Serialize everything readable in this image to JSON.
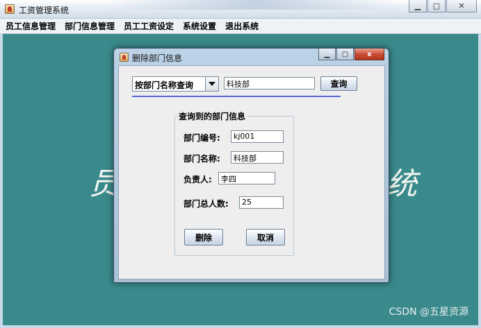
{
  "main_window": {
    "title": "工资管理系统",
    "controls": {
      "minimize": "▁",
      "maximize": "▢",
      "close": "✕"
    }
  },
  "menu": {
    "items": [
      "员工信息管理",
      "部门信息管理",
      "员工工资设定",
      "系统设置",
      "退出系统"
    ]
  },
  "background": {
    "left_glyph": "员",
    "right_glyph": "统",
    "watermark": "CSDN @五星资源"
  },
  "dialog": {
    "title": "删除部门信息",
    "controls": {
      "minimize": "▁",
      "maximize": "▢",
      "close": "x"
    },
    "search": {
      "mode_selected": "按部门名称查询",
      "keyword": "科技部",
      "search_button": "查询"
    },
    "group": {
      "title": "查询到的部门信息",
      "fields": {
        "dept_id": {
          "label": "部门编号:",
          "value": "kj001"
        },
        "dept_name": {
          "label": "部门名称:",
          "value": "科技部"
        },
        "manager": {
          "label": "负责人:",
          "value": "李四"
        },
        "headcount": {
          "label": "部门总人数:",
          "value": "25"
        }
      },
      "delete_button": "删除",
      "cancel_button": "取消"
    }
  },
  "colors": {
    "desktop": "#3a8a8c",
    "accent_line": "#5566dd",
    "close_button": "#c74a33"
  }
}
